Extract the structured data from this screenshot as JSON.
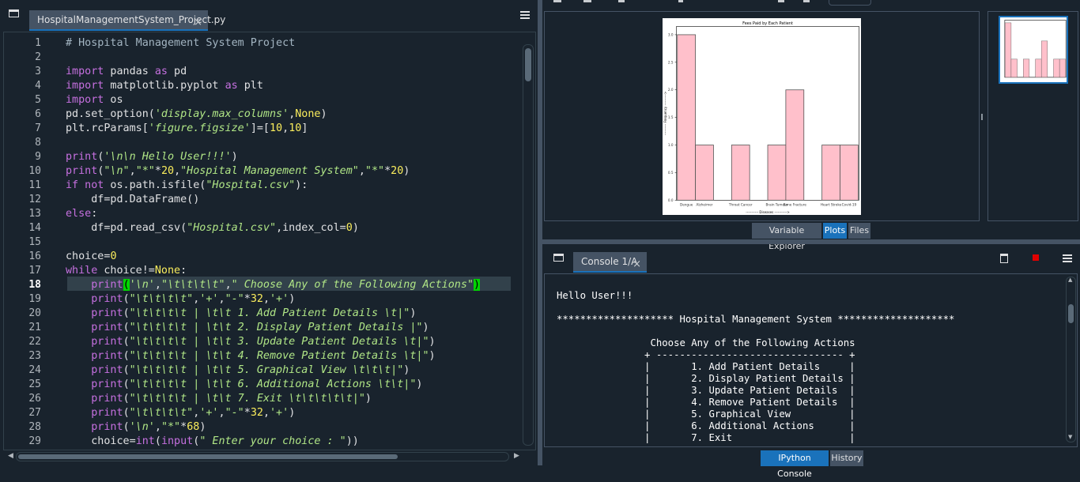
{
  "editor": {
    "tab_title": "HospitalManagementSystem_Project.py",
    "tab_close": "×",
    "current_line": 18,
    "lines": [
      {
        "n": "1",
        "html": "<span class='cm'># Hospital Management System Project</span>"
      },
      {
        "n": "2",
        "html": ""
      },
      {
        "n": "3",
        "html": "<span class='k'>import</span> pandas <span class='k'>as</span> pd"
      },
      {
        "n": "4",
        "html": "<span class='k'>import</span> matplotlib.pyplot <span class='k'>as</span> plt"
      },
      {
        "n": "5",
        "html": "<span class='k'>import</span> os"
      },
      {
        "n": "6",
        "html": "pd.set_option(<span class='s'>'display.max_columns'</span>,<span class='n'>None</span>)"
      },
      {
        "n": "7",
        "html": "plt.rcParams[<span class='s'>'figure.figsize'</span>]=[<span class='n'>10</span>,<span class='n'>10</span>]"
      },
      {
        "n": "8",
        "html": ""
      },
      {
        "n": "9",
        "html": "<span class='k'>print</span>(<span class='s'>'\\n\\n Hello User!!!'</span>)"
      },
      {
        "n": "10",
        "html": "<span class='k'>print</span>(<span class='s'>\"\\n\"</span>,<span class='s'>\"*\"</span>*<span class='n'>20</span>,<span class='s'>\"Hospital Management System\"</span>,<span class='s'>\"*\"</span>*<span class='n'>20</span>)"
      },
      {
        "n": "11",
        "html": "<span class='k'>if not</span> os.path.isfile(<span class='s'>\"Hospital.csv\"</span>):"
      },
      {
        "n": "12",
        "html": "    df=pd.DataFrame()"
      },
      {
        "n": "13",
        "html": "<span class='k'>else</span>:"
      },
      {
        "n": "14",
        "html": "    df=pd.read_csv(<span class='s'>\"Hospital.csv\"</span>,index_col=<span class='n'>0</span>)"
      },
      {
        "n": "15",
        "html": ""
      },
      {
        "n": "16",
        "html": "choice=<span class='n'>0</span>"
      },
      {
        "n": "17",
        "html": "<span class='k'>while</span> choice!=<span class='n'>None</span>:"
      },
      {
        "n": "18",
        "html": "    <span class='k'>print</span><span class='br'>(</span><span class='s'>'\\n'</span>,<span class='s'>\"\\t\\t\\t\\t\"</span>,<span class='s'>\" Choose Any of the Following Actions\"</span><span class='br'>)</span>"
      },
      {
        "n": "19",
        "html": "    <span class='k'>print</span>(<span class='s'>\"\\t\\t\\t\\t\"</span>,<span class='s'>'+'</span>,<span class='s'>\"-\"</span>*<span class='n'>32</span>,<span class='s'>'+'</span>)"
      },
      {
        "n": "20",
        "html": "    <span class='k'>print</span>(<span class='s'>\"\\t\\t\\t\\t | \\t\\t 1. Add Patient Details \\t|\"</span>)"
      },
      {
        "n": "21",
        "html": "    <span class='k'>print</span>(<span class='s'>\"\\t\\t\\t\\t | \\t\\t 2. Display Patient Details |\"</span>)"
      },
      {
        "n": "22",
        "html": "    <span class='k'>print</span>(<span class='s'>\"\\t\\t\\t\\t | \\t\\t 3. Update Patient Details \\t|\"</span>)"
      },
      {
        "n": "23",
        "html": "    <span class='k'>print</span>(<span class='s'>\"\\t\\t\\t\\t | \\t\\t 4. Remove Patient Details \\t|\"</span>)"
      },
      {
        "n": "24",
        "html": "    <span class='k'>print</span>(<span class='s'>\"\\t\\t\\t\\t | \\t\\t 5. Graphical View \\t\\t\\t|\"</span>)"
      },
      {
        "n": "25",
        "html": "    <span class='k'>print</span>(<span class='s'>\"\\t\\t\\t\\t | \\t\\t 6. Additional Actions \\t\\t|\"</span>)"
      },
      {
        "n": "26",
        "html": "    <span class='k'>print</span>(<span class='s'>\"\\t\\t\\t\\t | \\t\\t 7. Exit \\t\\t\\t\\t\\t|\"</span>)"
      },
      {
        "n": "27",
        "html": "    <span class='k'>print</span>(<span class='s'>\"\\t\\t\\t\\t\"</span>,<span class='s'>'+'</span>,<span class='s'>\"-\"</span>*<span class='n'>32</span>,<span class='s'>'+'</span>)"
      },
      {
        "n": "28",
        "html": "    <span class='k'>print</span>(<span class='s'>'\\n'</span>,<span class='s'>\"*\"</span>*<span class='n'>68</span>)"
      },
      {
        "n": "29",
        "html": "    choice=<span class='k'>int</span>(<span class='k'>input</span>(<span class='s'>\" Enter your choice : \"</span>))"
      }
    ]
  },
  "plots": {
    "tabs": [
      {
        "label": "Variable Explorer",
        "active": false
      },
      {
        "label": "Plots",
        "active": true
      },
      {
        "label": "Files",
        "active": false
      }
    ]
  },
  "console": {
    "tab_title": "Console 1/A",
    "tab_close": "×",
    "lines": [
      "Hello User!!!",
      "",
      "******************** Hospital Management System ********************",
      "",
      "                Choose Any of the Following Actions",
      "               + -------------------------------- +",
      "               |       1. Add Patient Details     |",
      "               |       2. Display Patient Details |",
      "               |       3. Update Patient Details  |",
      "               |       4. Remove Patient Details  |",
      "               |       5. Graphical View          |",
      "               |       6. Additional Actions      |",
      "               |       7. Exit                    |"
    ],
    "tabs": [
      {
        "label": "IPython Console",
        "active": true
      },
      {
        "label": "History",
        "active": false
      }
    ]
  },
  "chart_data": {
    "type": "bar",
    "title": "Fees Paid by Each Patient",
    "xlabel": "----------- Diseases ----------->",
    "ylabel": "---------- Frequency ---------->",
    "categories": [
      "Dengue",
      "Alzheimer",
      "",
      "Throat Cancer",
      "",
      "Brain Tumour",
      "Bone Fracture",
      "",
      "Heart Stroke",
      "Covid-19"
    ],
    "values": [
      3,
      1,
      0,
      1,
      0,
      1,
      2,
      0,
      1,
      1
    ],
    "yticks": [
      "0.0",
      "0.5",
      "1.0",
      "1.5",
      "2.0",
      "2.5",
      "3.0"
    ],
    "ylim": [
      0,
      3.15
    ],
    "bar_color": "#ffc0cb",
    "edge_color": "#555555"
  }
}
